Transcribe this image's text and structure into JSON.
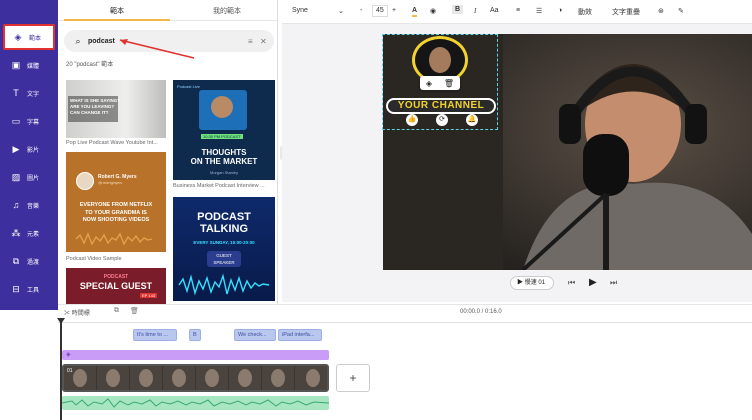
{
  "sidebar": {
    "items": [
      {
        "label": "範本",
        "icon": "layers-icon",
        "active": true
      },
      {
        "label": "媒體",
        "icon": "media-icon"
      },
      {
        "label": "文字",
        "icon": "text-icon"
      },
      {
        "label": "字幕",
        "icon": "subtitle-icon"
      },
      {
        "label": "影片",
        "icon": "video-icon"
      },
      {
        "label": "圖片",
        "icon": "image-icon"
      },
      {
        "label": "音樂",
        "icon": "music-icon"
      },
      {
        "label": "元素",
        "icon": "elements-icon"
      },
      {
        "label": "過渡",
        "icon": "transition-icon"
      },
      {
        "label": "工具",
        "icon": "tools-icon"
      }
    ]
  },
  "panel": {
    "tabs": [
      "範本",
      "我的範本"
    ],
    "search_value": "podcast",
    "result_count": "20 \"podcast\" 範本",
    "templates": [
      {
        "caption": "Pop Live Podcast Wave Youtube Int...",
        "lines": [
          "WHAT IS SHE SAYING?",
          "ARE YOU LEAVING?",
          "CAN CHANGE IT?"
        ]
      },
      {
        "caption": "Business Market Podcast Interview ...",
        "lines": [
          "Podcast Live",
          "10:30 PM PODCAST",
          "THOUGHTS",
          "ON THE MARKET",
          "Morgan Stanley"
        ]
      },
      {
        "caption": "Podcast Video Sample",
        "lines": [
          "Robert G. Myers",
          "@robertgmyers",
          "EVERYONE FROM NETFLIX",
          "TO YOUR GRANDMA IS",
          "NOW SHOOTING VIDEOS"
        ]
      },
      {
        "caption": "",
        "lines": [
          "PODCAST",
          "TALKING",
          "EVERY SUNDAY, 15:00-20:00",
          "GUEST",
          "SPEAKER"
        ]
      },
      {
        "caption": "",
        "lines": [
          "PODCAST",
          "SPECIAL GUEST",
          "EP 143"
        ]
      }
    ]
  },
  "toolbar": {
    "font": "Syne",
    "font_size": "45",
    "minus": "-",
    "plus": "+",
    "animation": "動效",
    "text_overlay": "文字重疊"
  },
  "canvas": {
    "channel_text": "YOUR CHANNEL"
  },
  "playbar": {
    "speed": "慢速 01",
    "time": "00:00.0 / 0:16.0"
  },
  "timeline": {
    "split_label": "時間標",
    "text_clips": [
      "It's time to ...",
      "B",
      "We check...",
      "iPad interfa..."
    ],
    "video_track_label": "01",
    "add_symbol": "+"
  },
  "colors": {
    "sidebar_bg": "#3d2f9e",
    "accent": "#f2b94a",
    "highlight_red": "#e0312e",
    "track_purple": "#c89cf7",
    "audio_green": "#a7e6c0"
  }
}
